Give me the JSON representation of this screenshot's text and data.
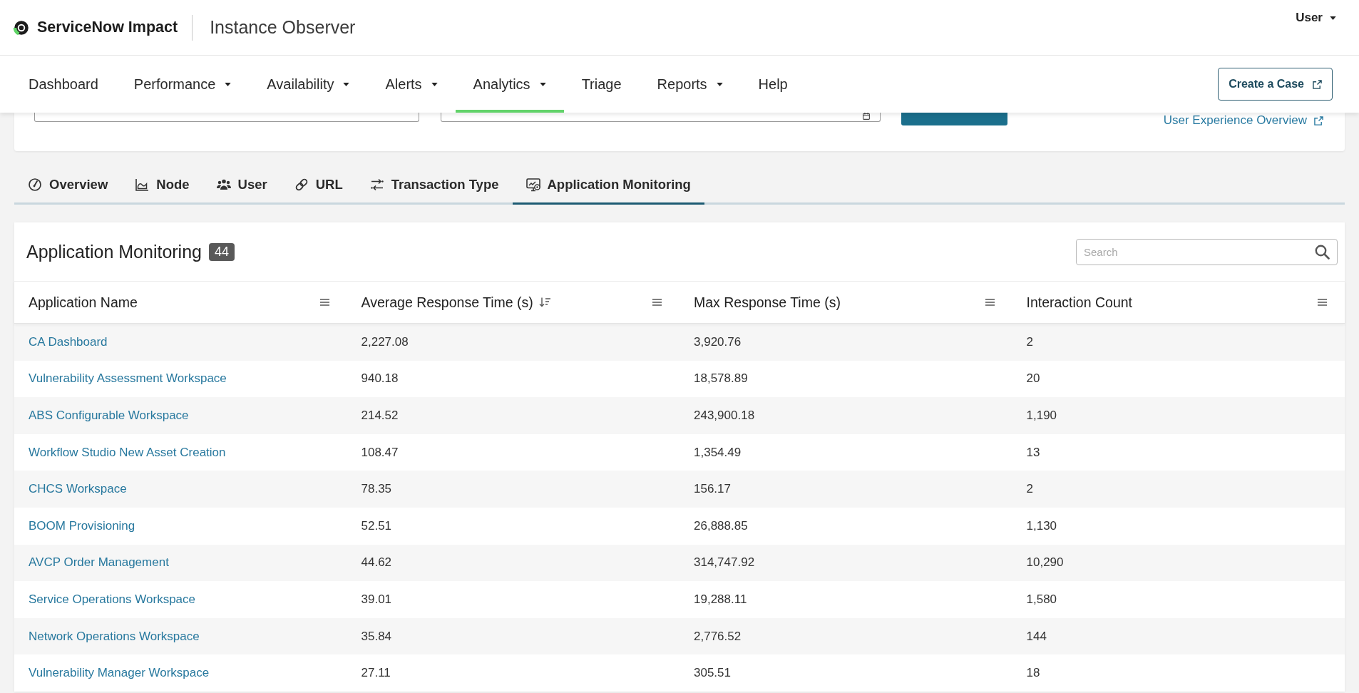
{
  "header": {
    "brand": "ServiceNow Impact",
    "product": "Instance Observer",
    "user_menu": "User"
  },
  "nav": {
    "items": [
      {
        "label": "Dashboard",
        "dropdown": false,
        "selected": false
      },
      {
        "label": "Performance",
        "dropdown": true,
        "selected": false
      },
      {
        "label": "Availability",
        "dropdown": true,
        "selected": false
      },
      {
        "label": "Alerts",
        "dropdown": true,
        "selected": false
      },
      {
        "label": "Analytics",
        "dropdown": true,
        "selected": true
      },
      {
        "label": "Triage",
        "dropdown": false,
        "selected": false
      },
      {
        "label": "Reports",
        "dropdown": true,
        "selected": false
      },
      {
        "label": "Help",
        "dropdown": false,
        "selected": false
      }
    ],
    "action_button": "Create a Case"
  },
  "filter_bar": {
    "link": "User Experience Overview"
  },
  "tabs": [
    {
      "label": "Overview",
      "selected": false
    },
    {
      "label": "Node",
      "selected": false
    },
    {
      "label": "User",
      "selected": false
    },
    {
      "label": "URL",
      "selected": false
    },
    {
      "label": "Transaction Type",
      "selected": false
    },
    {
      "label": "Application Monitoring",
      "selected": true
    }
  ],
  "table": {
    "title": "Application Monitoring",
    "count": "44",
    "search": {
      "placeholder": "Search"
    },
    "columns": [
      {
        "label": "Application Name",
        "sorted": false
      },
      {
        "label": "Average Response Time (s)",
        "sorted": true
      },
      {
        "label": "Max Response Time (s)",
        "sorted": false
      },
      {
        "label": "Interaction Count",
        "sorted": false
      }
    ],
    "rows": [
      [
        "CA Dashboard",
        "2,227.08",
        "3,920.76",
        "2"
      ],
      [
        "Vulnerability Assessment Workspace",
        "940.18",
        "18,578.89",
        "20"
      ],
      [
        "ABS Configurable Workspace",
        "214.52",
        "243,900.18",
        "1,190"
      ],
      [
        "Workflow Studio New Asset Creation",
        "108.47",
        "1,354.49",
        "13"
      ],
      [
        "CHCS Workspace",
        "78.35",
        "156.17",
        "2"
      ],
      [
        "BOOM Provisioning",
        "52.51",
        "26,888.85",
        "1,130"
      ],
      [
        "AVCP Order Management",
        "44.62",
        "314,747.92",
        "10,290"
      ],
      [
        "Service Operations Workspace",
        "39.01",
        "19,288.11",
        "1,580"
      ],
      [
        "Network Operations Workspace",
        "35.84",
        "2,776.52",
        "144"
      ],
      [
        "Vulnerability Manager Workspace",
        "27.11",
        "305.51",
        "18"
      ]
    ]
  }
}
